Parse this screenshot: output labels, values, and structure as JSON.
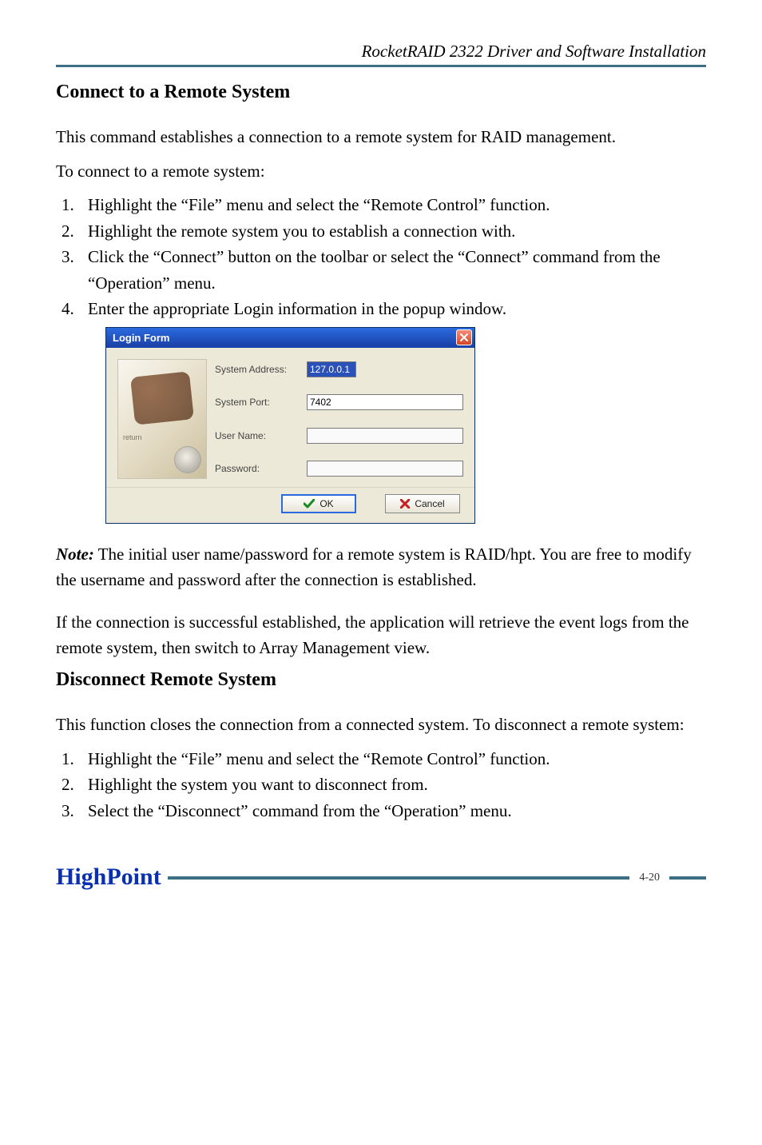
{
  "header": {
    "title_italic": "RocketRAID 2322 Driver and Software Installation"
  },
  "sections": {
    "connect": {
      "heading": "Connect to a Remote System",
      "intro1": "This command establishes a connection to a remote system for RAID management.",
      "intro2": "To connect to a remote system:",
      "steps": [
        "Highlight the “File” menu and select the “Remote Control” function.",
        "Highlight the remote system you to establish a connection with.",
        "Click the “Connect” button on the toolbar or select the “Connect” command from the “Operation” menu.",
        "Enter the appropriate Login information in the popup window."
      ]
    },
    "dialog": {
      "title": "Login Form",
      "art_label": "return",
      "labels": {
        "system_address": "System Address:",
        "system_port": "System Port:",
        "user_name": "User Name:",
        "password": "Password:"
      },
      "values": {
        "system_address": "127.0.0.1",
        "system_port": "7402",
        "user_name": "",
        "password": ""
      },
      "buttons": {
        "ok": "OK",
        "cancel": "Cancel"
      }
    },
    "note": {
      "label": "Note:",
      "text": " The initial user name/password for a remote system is RAID/hpt.  You are free to modify the username and password after the connection is established."
    },
    "after_note": "If the connection is successful established, the application will retrieve the event logs from the remote system, then switch to Array Management view.",
    "disconnect": {
      "heading": "Disconnect Remote System",
      "intro": "This function closes the connection from a connected system.  To disconnect a remote system:",
      "steps": [
        "Highlight the “File” menu and select the “Remote Control” function.",
        "Highlight the system you want to disconnect from.",
        "Select the “Disconnect” command from the “Operation” menu."
      ]
    }
  },
  "footer": {
    "logo_text": "HighPoint",
    "page_number": "4-20"
  },
  "colors": {
    "rule": "#3c6e85",
    "logo": "#0930b2",
    "titlebar": "#1a3fa3"
  }
}
